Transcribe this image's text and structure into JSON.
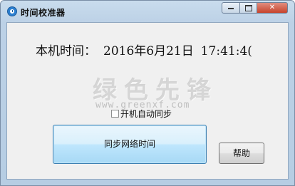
{
  "window": {
    "title": "时间校准器",
    "icon": "clock-icon"
  },
  "clock": {
    "label": "本机时间：",
    "date": "2016年6月21日",
    "time": "17:41:4("
  },
  "watermark": {
    "text": "绿色先锋",
    "url": "www.greenxf.com"
  },
  "autostart": {
    "label": "开机自动同步",
    "checked": false
  },
  "buttons": {
    "sync": "同步网络时间",
    "help": "帮助"
  },
  "colors": {
    "sync_border": "#3c7fb1",
    "close_button": "#c7432c"
  }
}
